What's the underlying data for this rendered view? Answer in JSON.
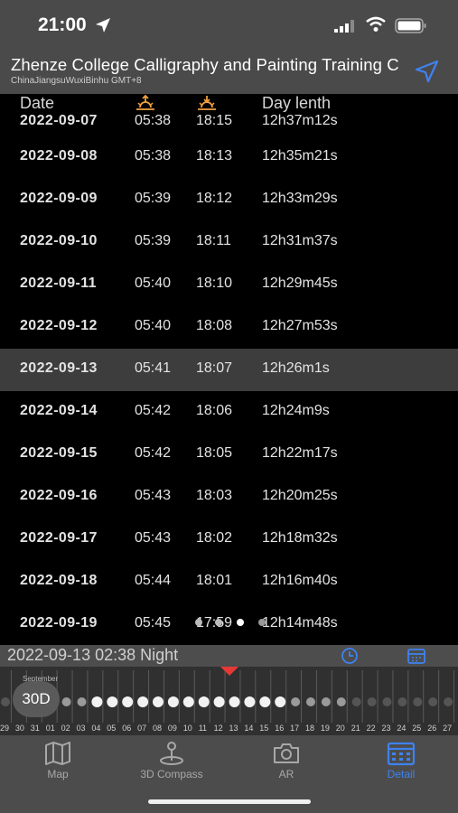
{
  "status": {
    "time": "21:00"
  },
  "header": {
    "title": "Zhenze College Calligraphy and Painting Training C",
    "subtitle": "ChinaJiangsuWuxiBinhu GMT+8"
  },
  "columns": {
    "date": "Date",
    "day_length": "Day lenth"
  },
  "partial_row": {
    "date": "2022-09-07",
    "sunrise": "05:38",
    "sunset": "18:15",
    "length": "12h37m12s"
  },
  "rows": [
    {
      "date": "2022-09-08",
      "sunrise": "05:38",
      "sunset": "18:13",
      "length": "12h35m21s"
    },
    {
      "date": "2022-09-09",
      "sunrise": "05:39",
      "sunset": "18:12",
      "length": "12h33m29s"
    },
    {
      "date": "2022-09-10",
      "sunrise": "05:39",
      "sunset": "18:11",
      "length": "12h31m37s"
    },
    {
      "date": "2022-09-11",
      "sunrise": "05:40",
      "sunset": "18:10",
      "length": "12h29m45s"
    },
    {
      "date": "2022-09-12",
      "sunrise": "05:40",
      "sunset": "18:08",
      "length": "12h27m53s"
    },
    {
      "date": "2022-09-13",
      "sunrise": "05:41",
      "sunset": "18:07",
      "length": "12h26m1s"
    },
    {
      "date": "2022-09-14",
      "sunrise": "05:42",
      "sunset": "18:06",
      "length": "12h24m9s"
    },
    {
      "date": "2022-09-15",
      "sunrise": "05:42",
      "sunset": "18:05",
      "length": "12h22m17s"
    },
    {
      "date": "2022-09-16",
      "sunrise": "05:43",
      "sunset": "18:03",
      "length": "12h20m25s"
    },
    {
      "date": "2022-09-17",
      "sunrise": "05:43",
      "sunset": "18:02",
      "length": "12h18m32s"
    },
    {
      "date": "2022-09-18",
      "sunrise": "05:44",
      "sunset": "18:01",
      "length": "12h16m40s"
    },
    {
      "date": "2022-09-19",
      "sunrise": "05:45",
      "sunset": "17:59",
      "length": "12h14m48s"
    }
  ],
  "selected_date": "2022-09-13",
  "info_bar": {
    "text": "2022-09-13 02:38 Night"
  },
  "timeline": {
    "month": "September",
    "zoom": "30D",
    "days": [
      "29",
      "30",
      "31",
      "01",
      "02",
      "03",
      "04",
      "05",
      "06",
      "07",
      "08",
      "09",
      "10",
      "11",
      "12",
      "13",
      "14",
      "15",
      "16",
      "17",
      "18",
      "19",
      "20",
      "21",
      "22",
      "23",
      "24",
      "25",
      "26",
      "27"
    ]
  },
  "tabs": [
    {
      "label": "Map"
    },
    {
      "label": "3D Compass"
    },
    {
      "label": "AR"
    },
    {
      "label": "Detail"
    }
  ],
  "colors": {
    "accent": "#3f82f0",
    "marker": "#e53935",
    "sun_icon": "#f0a040"
  }
}
